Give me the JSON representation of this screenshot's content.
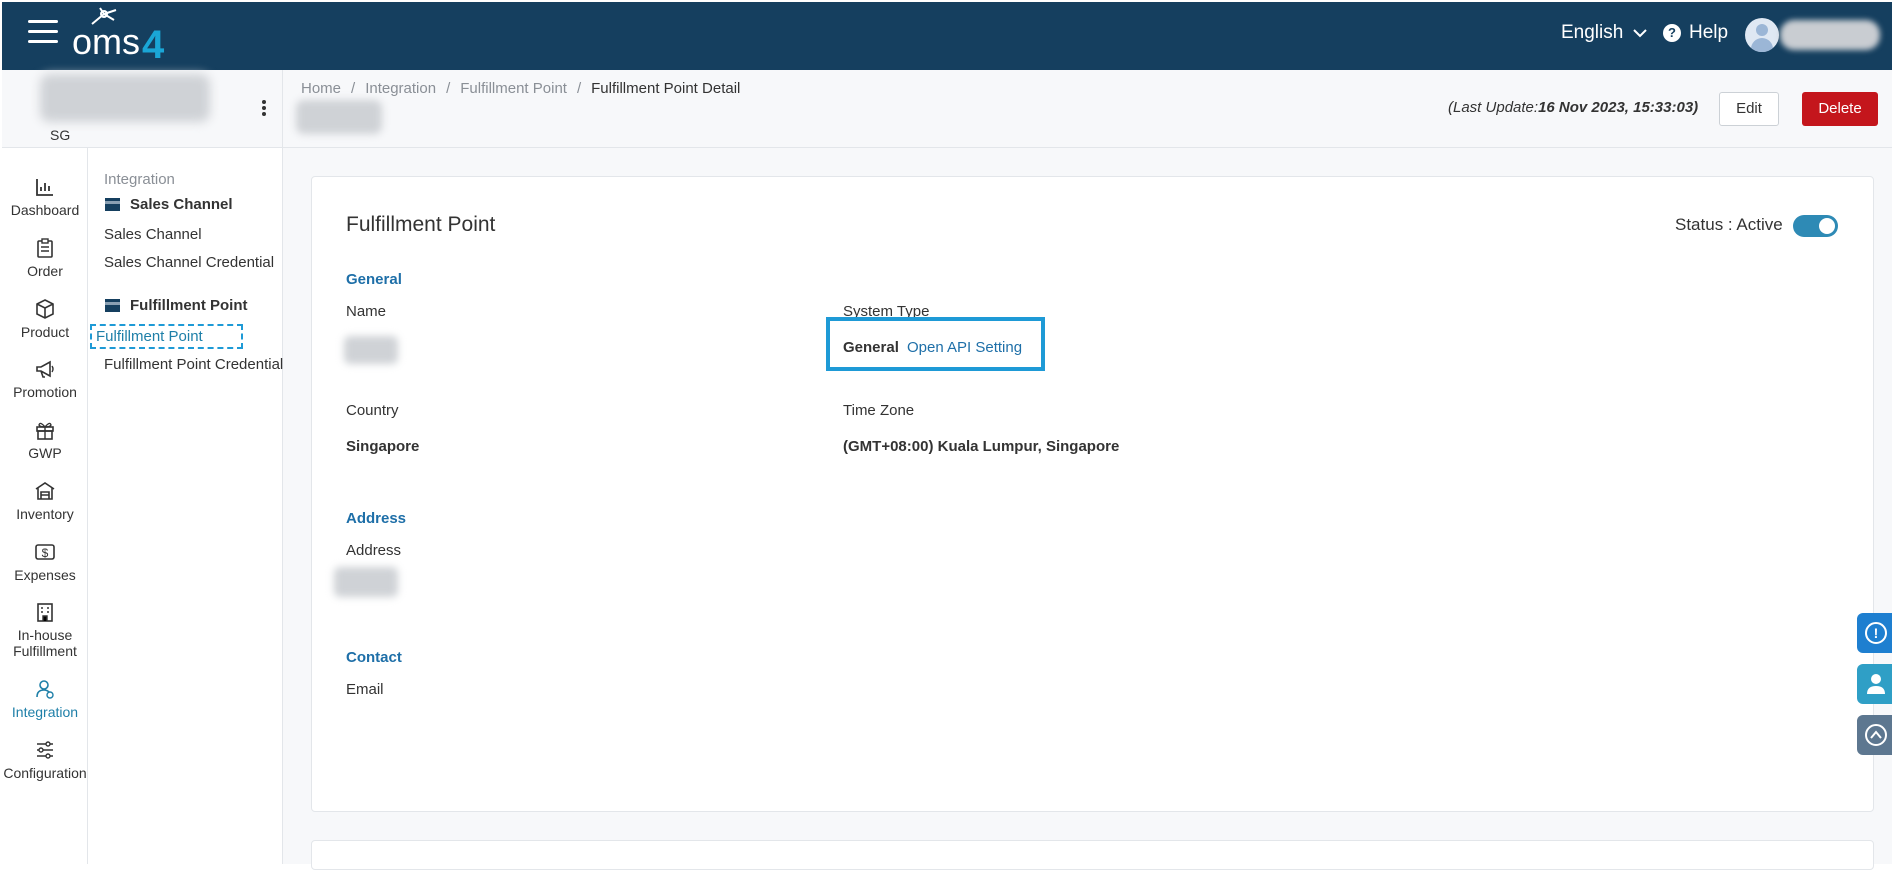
{
  "app": {
    "logo_text": "oms4",
    "language": "English",
    "help_label": "Help"
  },
  "store": {
    "region_label": "SG"
  },
  "breadcrumb": [
    "Home",
    "Integration",
    "Fulfillment Point",
    "Fulfillment Point Detail"
  ],
  "header": {
    "last_update_prefix": "(Last Update:",
    "last_update_value": "16 Nov 2023, 15:33:03)",
    "edit_label": "Edit",
    "delete_label": "Delete"
  },
  "leftnav": [
    {
      "label": "Dashboard",
      "icon": "bar-chart-icon"
    },
    {
      "label": "Order",
      "icon": "clipboard-icon"
    },
    {
      "label": "Product",
      "icon": "box-icon"
    },
    {
      "label": "Promotion",
      "icon": "megaphone-icon"
    },
    {
      "label": "GWP",
      "icon": "gift-icon"
    },
    {
      "label": "Inventory",
      "icon": "warehouse-icon"
    },
    {
      "label": "Expenses",
      "icon": "dollar-icon"
    },
    {
      "label": "In-house Fulfillment",
      "icon": "building-icon"
    },
    {
      "label": "Integration",
      "icon": "integration-user-icon"
    },
    {
      "label": "Configuration",
      "icon": "sliders-icon"
    }
  ],
  "submenu": {
    "group_label": "Integration",
    "sales_channel_head": "Sales Channel",
    "sales_channel_items": [
      "Sales Channel",
      "Sales Channel Credential"
    ],
    "fulfillment_head": "Fulfillment Point",
    "fulfillment_items": [
      "Fulfillment Point",
      "Fulfillment Point Credential"
    ]
  },
  "card": {
    "title": "Fulfillment Point",
    "status_label": "Status : Active",
    "status_active": true,
    "general_head": "General",
    "name_label": "Name",
    "system_type_label": "System Type",
    "system_type_value": "General",
    "system_type_link": "Open API Setting",
    "country_label": "Country",
    "country_value": "Singapore",
    "timezone_label": "Time Zone",
    "timezone_value": "(GMT+08:00) Kuala Lumpur, Singapore",
    "address_head": "Address",
    "address_label": "Address",
    "contact_head": "Contact",
    "email_label": "Email"
  },
  "colors": {
    "topbar": "#153f5f",
    "accent": "#1e6fa8",
    "delete": "#c4161c",
    "toggle": "#2e8ab5"
  }
}
